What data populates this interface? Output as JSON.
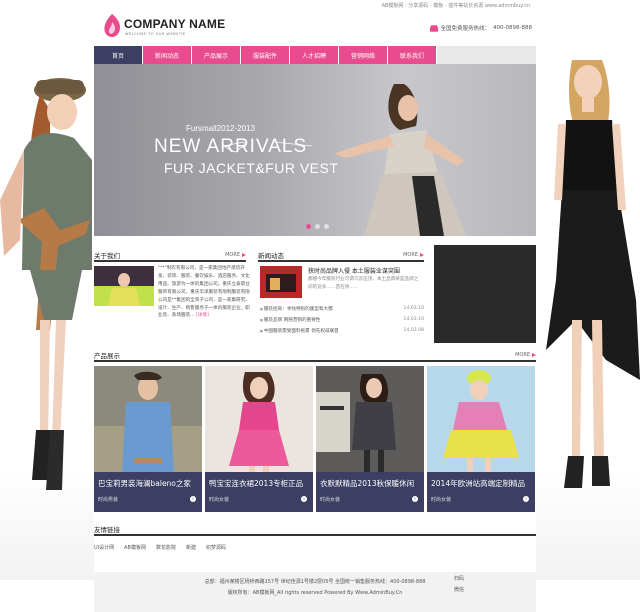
{
  "topbar": {
    "text": "AB模板网 : 分享源码 - 模板 - 插件等站长资源 www.adminbuy.cn"
  },
  "logo": {
    "name": "COMPANY NAME",
    "tagline": "WELCOME TO OUR WEBSITE"
  },
  "hotline": {
    "label": "全国免费服务热线：",
    "number": "400-0898-888"
  },
  "nav": [
    {
      "label": "首页",
      "active": true
    },
    {
      "label": "新闻动态"
    },
    {
      "label": "产品展示"
    },
    {
      "label": "服装配件"
    },
    {
      "label": "人才招聘"
    },
    {
      "label": "营销网络"
    },
    {
      "label": "联系我们"
    }
  ],
  "banner": {
    "subtitle": "Fursmall2012-2013",
    "title": "NEW ARRIVALS",
    "title2": "FUR JACKET&FUR VEST"
  },
  "about": {
    "heading": "关于我们",
    "more": "MORE",
    "text": "\"**\"制衣有限公司，是一家集团地产建筑开发、装饰、服装、餐饮娱乐、酒店服务、文化用品、旅游为一体的集团公司。重庆立泰职业服饰有限公司，重庆华泽服装有限制服装有限公司是**集团的全资子公司，是一家集研究、设计、生产、销售服务于一体的服装企业，职业装、系场服装...",
    "more_link": "[详情]"
  },
  "news": {
    "heading": "新闻动态",
    "more": "MORE",
    "featured_title": "狭时尚品牌入侵 本土服装业谋突围",
    "featured_desc": "都擅今年服装行业可谓乌云压顶，本土品牌将是品牌之间的竞争……首在将……",
    "items": [
      {
        "title": "服装招商：寻找特别的版型和大都",
        "date": "14.03.10"
      },
      {
        "title": "服装品牌  网络营销的重要性",
        "date": "14.03.10"
      },
      {
        "title": "中国服装需受面料拖累 领先权威联首",
        "date": "14.03.08"
      }
    ]
  },
  "products": {
    "heading": "产品展示",
    "more": "MORE",
    "items": [
      {
        "title": "巴宝莉男装海澜baleno之家",
        "category": "时尚男装"
      },
      {
        "title": "鸭宝宝连衣裙2013专柜正品",
        "category": "时尚女装"
      },
      {
        "title": "衣默默精品2013秋保暖休闲",
        "category": "时尚女装"
      },
      {
        "title": "2014年欧洲站高端定制精品",
        "category": "时尚女装"
      }
    ]
  },
  "links": {
    "heading": "友情链接",
    "items": [
      "UI设计网",
      "AB模板网",
      "数花影院",
      "新建",
      "织梦源码"
    ]
  },
  "footer": {
    "line1": "总部：福州某楼区杨桥西路157号 世纪佳源1号楼2层05号    全国统一销售服务热线：400-0898-888",
    "line2": "版权所有：AB模板网_All rights reserved Powered By Www.AdminBuy.Cn"
  },
  "side_note": [
    "扫码",
    "微信"
  ],
  "colors": {
    "accent": "#e94c8e",
    "navy": "#3c3f63"
  }
}
